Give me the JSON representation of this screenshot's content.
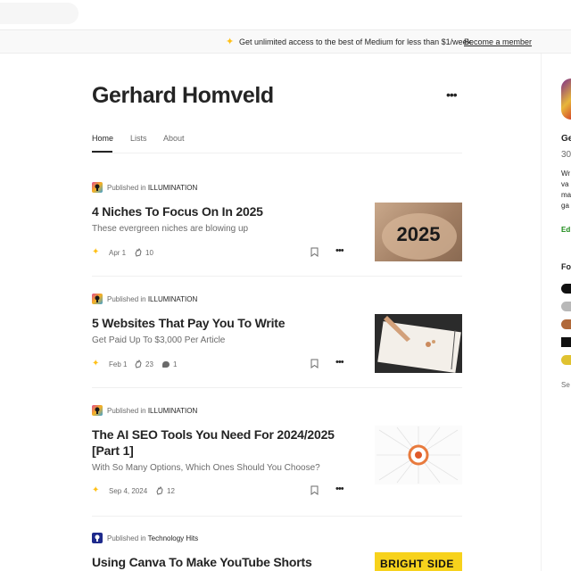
{
  "banner": {
    "text": "Get unlimited access to the best of Medium for less than $1/week.",
    "link": "Become a member"
  },
  "profile": {
    "name": "Gerhard Homveld",
    "more": "•••"
  },
  "tabs": [
    {
      "label": "Home",
      "active": true
    },
    {
      "label": "Lists",
      "active": false
    },
    {
      "label": "About",
      "active": false
    }
  ],
  "articles": [
    {
      "pub_prefix": "Published in",
      "publication": "ILLUMINATION",
      "title": "4 Niches To Focus On In 2025",
      "subtitle": "These evergreen niches are blowing up",
      "date": "Apr 1",
      "claps": "10",
      "responses": "",
      "thumb_text": "2025"
    },
    {
      "pub_prefix": "Published in",
      "publication": "ILLUMINATION",
      "title": "5 Websites That Pay You To Write",
      "subtitle": "Get Paid Up To $3,000 Per Article",
      "date": "Feb 1",
      "claps": "23",
      "responses": "1",
      "thumb_text": ""
    },
    {
      "pub_prefix": "Published in",
      "publication": "ILLUMINATION",
      "title": "The AI SEO Tools You Need For 2024/2025 [Part 1]",
      "subtitle": "With So Many Options, Which Ones Should You Choose?",
      "date": "Sep 4, 2024",
      "claps": "12",
      "responses": "",
      "thumb_text": ""
    },
    {
      "pub_prefix": "Published in",
      "publication": "Technology Hits",
      "title": "Using Canva To Make YouTube Shorts",
      "subtitle": "",
      "date": "",
      "claps": "",
      "responses": "",
      "thumb_text": "BRIGHT SIDE"
    }
  ],
  "sidebar": {
    "name_fragment": "Ge",
    "followers_fragment": "30",
    "bio_fragments": [
      "Wr",
      "va",
      "ma",
      "ga"
    ],
    "edit_fragment": "Ed",
    "following_fragment": "Fo",
    "see_all_fragment": "Se"
  },
  "colors": {
    "accent_star": "#ffc017",
    "text_primary": "#242424",
    "text_secondary": "#6b6b6b",
    "edit_green": "#1a8917"
  },
  "icons": [
    "sparkle-icon",
    "more-icon",
    "publication-logo",
    "star-icon",
    "clap-icon",
    "response-icon",
    "bookmark-icon"
  ]
}
